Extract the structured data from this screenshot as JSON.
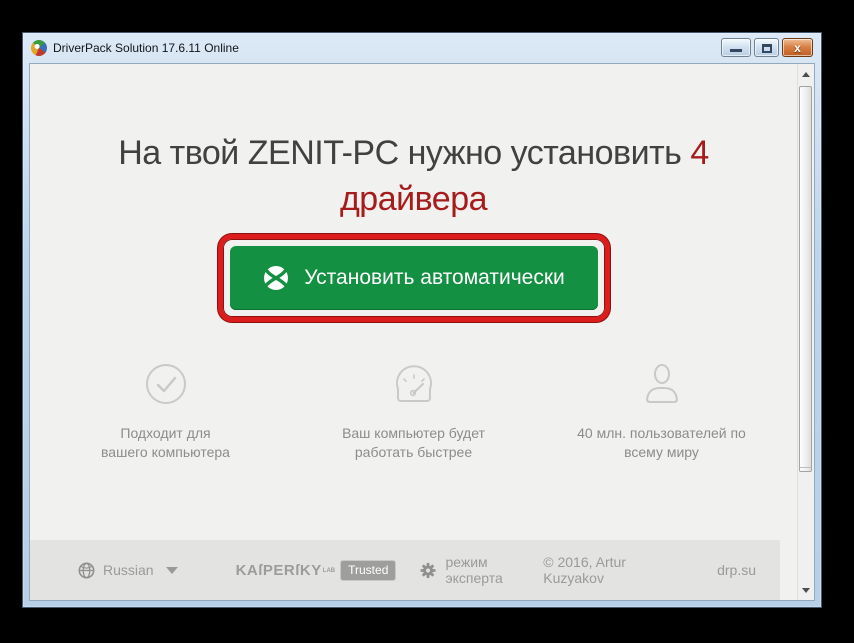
{
  "window": {
    "title": "DriverPack Solution 17.6.11 Online",
    "controls": {
      "close_glyph": "x"
    }
  },
  "heading": {
    "line1_dark": "На твой ZENIT-PC нужно установить",
    "count": "4",
    "line2_red": "драйвера"
  },
  "cta": {
    "label": "Установить автоматически"
  },
  "features": [
    {
      "icon": "check-circle-icon",
      "line1": "Подходит для",
      "line2": "вашего компьютера"
    },
    {
      "icon": "speedometer-icon",
      "line1": "Ваш компьютер будет",
      "line2": "работать быстрее"
    },
    {
      "icon": "user-icon",
      "line1": "40 млн. пользователей по",
      "line2": "всему миру"
    }
  ],
  "footer": {
    "language": "Russian",
    "kaspersky_wordmark": "KAſPERſKY",
    "kaspersky_lab": "LAB",
    "trusted_badge": "Trusted",
    "expert_mode": "режим эксперта",
    "copyright": "© 2016, Artur Kuzyakov",
    "site": "drp.su"
  },
  "colors": {
    "accent_green": "#149042",
    "annotation_red": "#dc1d1d",
    "heading_red": "#a61c1c",
    "heading_dark": "#414141",
    "footer_bg": "#e3e3e1"
  }
}
